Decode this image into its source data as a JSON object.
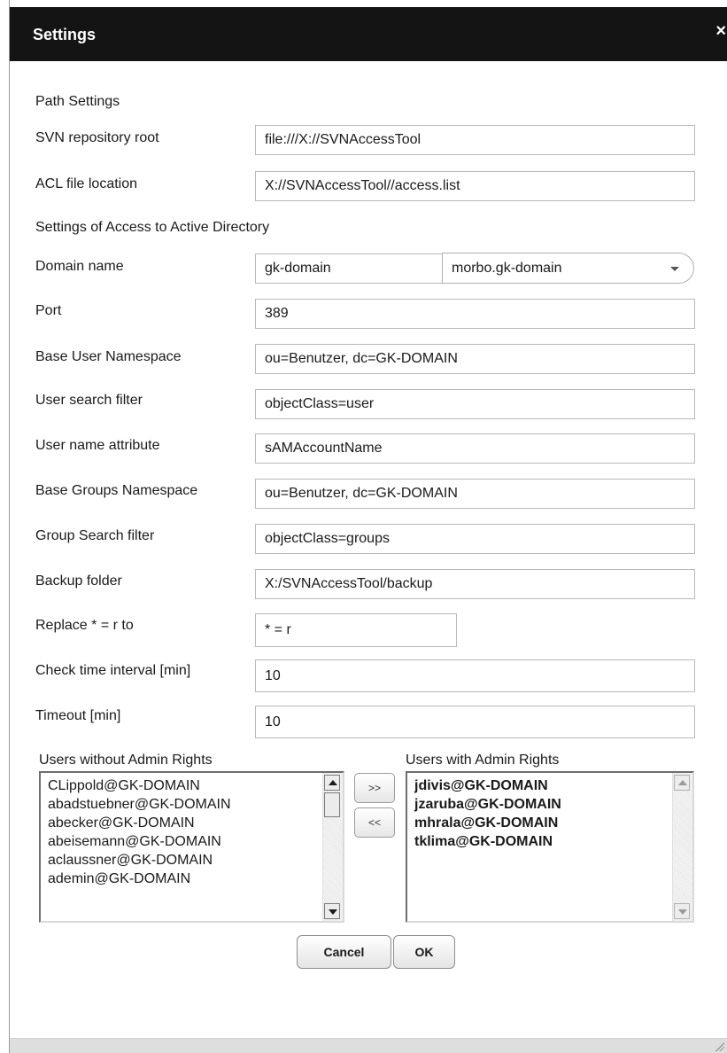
{
  "dialog": {
    "title": "Settings",
    "close_glyph": "×",
    "close_icon": "close-icon"
  },
  "path_settings": {
    "heading": "Path Settings",
    "svn_root_label": "SVN repository root",
    "svn_root_value": "file:///X://SVNAccessTool",
    "acl_label": "ACL file location",
    "acl_value": "X://SVNAccessTool//access.list"
  },
  "ad_settings": {
    "heading": "Settings of Access to Active Directory",
    "domain_label": "Domain name",
    "domain_value": "gk-domain",
    "domain_controller_selected": "morbo.gk-domain",
    "port_label": "Port",
    "port_value": "389",
    "base_user_ns_label": "Base User Namespace",
    "base_user_ns_value": "ou=Benutzer, dc=GK-DOMAIN",
    "user_filter_label": "User search filter",
    "user_filter_value": "objectClass=user",
    "user_name_attr_label": "User name attribute",
    "user_name_attr_value": "sAMAccountName",
    "base_groups_ns_label": "Base Groups Namespace",
    "base_groups_ns_value": "ou=Benutzer, dc=GK-DOMAIN",
    "group_filter_label": "Group Search filter",
    "group_filter_value": "objectClass=groups",
    "backup_label": "Backup folder",
    "backup_value": "X:/SVNAccessTool/backup",
    "replace_label": "Replace * = r to",
    "replace_value": "* = r",
    "check_interval_label": "Check time interval [min]",
    "check_interval_value": "10",
    "timeout_label": "Timeout [min]",
    "timeout_value": "10"
  },
  "users": {
    "without_admin_label": "Users without Admin Rights",
    "without_admin": [
      "CLippold@GK-DOMAIN",
      "abadstuebner@GK-DOMAIN",
      "abecker@GK-DOMAIN",
      "abeisemann@GK-DOMAIN",
      "aclaussner@GK-DOMAIN",
      "ademin@GK-DOMAIN"
    ],
    "with_admin_label": "Users with Admin Rights",
    "with_admin": [
      "jdivis@GK-DOMAIN",
      "jzaruba@GK-DOMAIN",
      "mhrala@GK-DOMAIN",
      "tklima@GK-DOMAIN"
    ],
    "add_label": ">>",
    "remove_label": "<<"
  },
  "buttons": {
    "cancel": "Cancel",
    "ok": "OK"
  }
}
